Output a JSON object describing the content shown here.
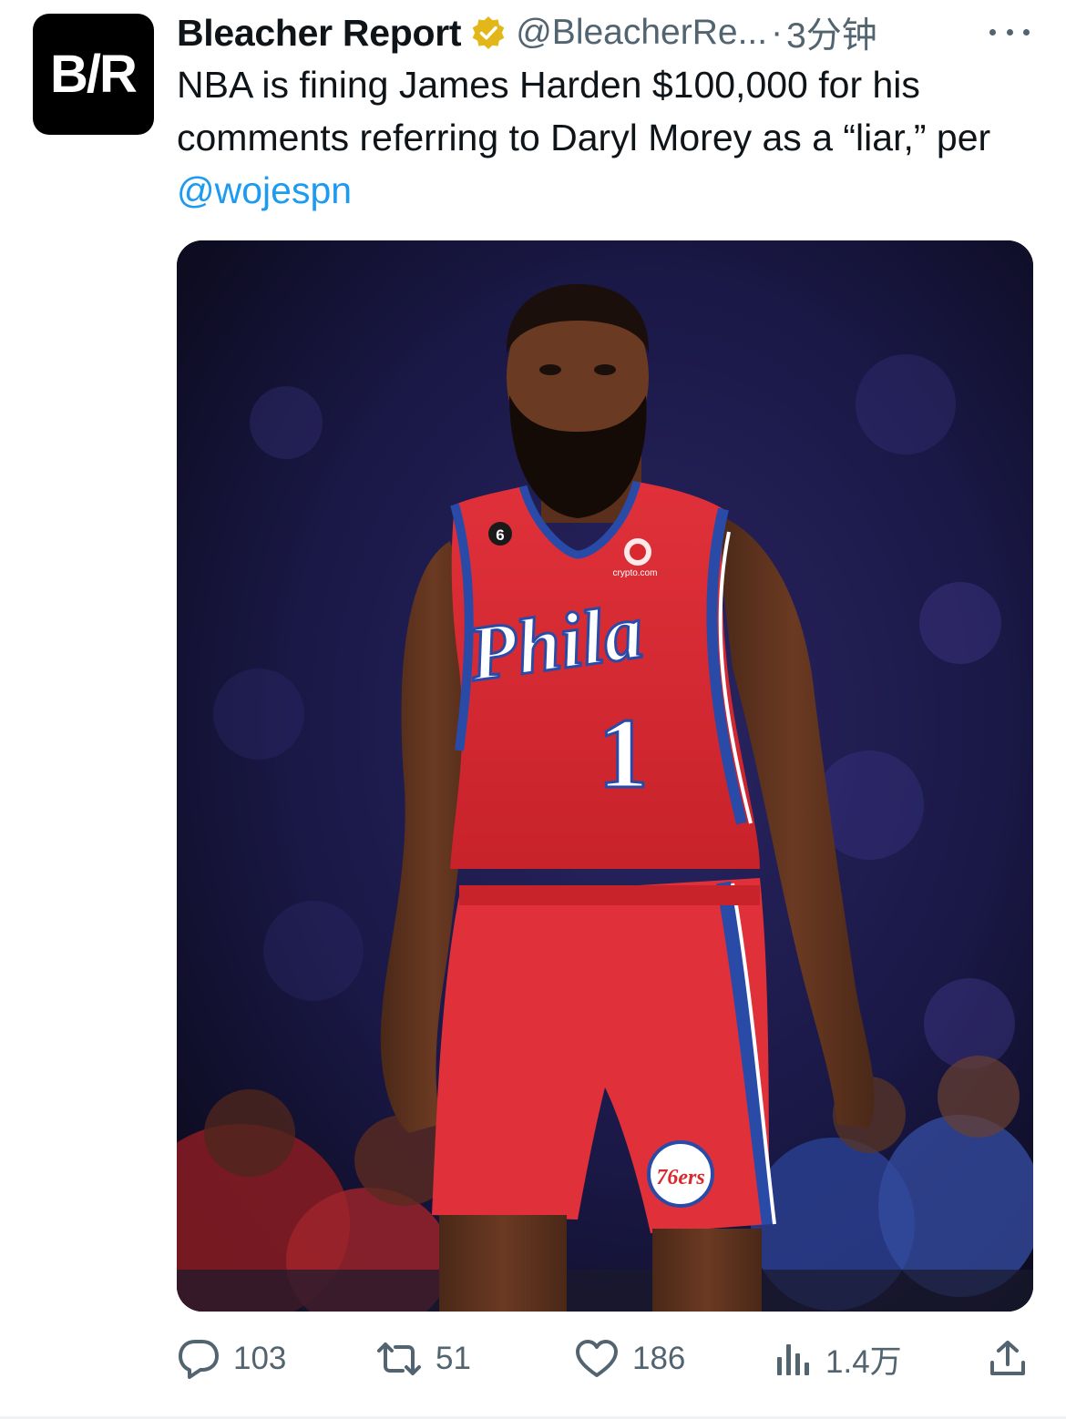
{
  "author": {
    "display_name": "Bleacher Report",
    "handle": "@BleacherRe...",
    "separator": "·",
    "time": "3分钟",
    "avatar_text": "B/R"
  },
  "tweet": {
    "text_before_mention": "NBA is fining James Harden $100,000 for his comments referring to Daryl Morey as a “liar,” per ",
    "mention": "@wojespn"
  },
  "media": {
    "icon": "photo",
    "jersey_wordmark": "Phila",
    "jersey_number": "1",
    "sponsor_text": "crypto.com",
    "patch_number": "6",
    "shorts_logo": "76ers"
  },
  "actions": {
    "reply_count": "103",
    "retweet_count": "51",
    "like_count": "186",
    "views_count": "1.4万"
  },
  "colors": {
    "link": "#1d9bf0",
    "secondary_text": "#536471",
    "verified_gold": "#e2b719",
    "jersey_red": "#d9282e",
    "jersey_blue": "#2a4aa8"
  }
}
